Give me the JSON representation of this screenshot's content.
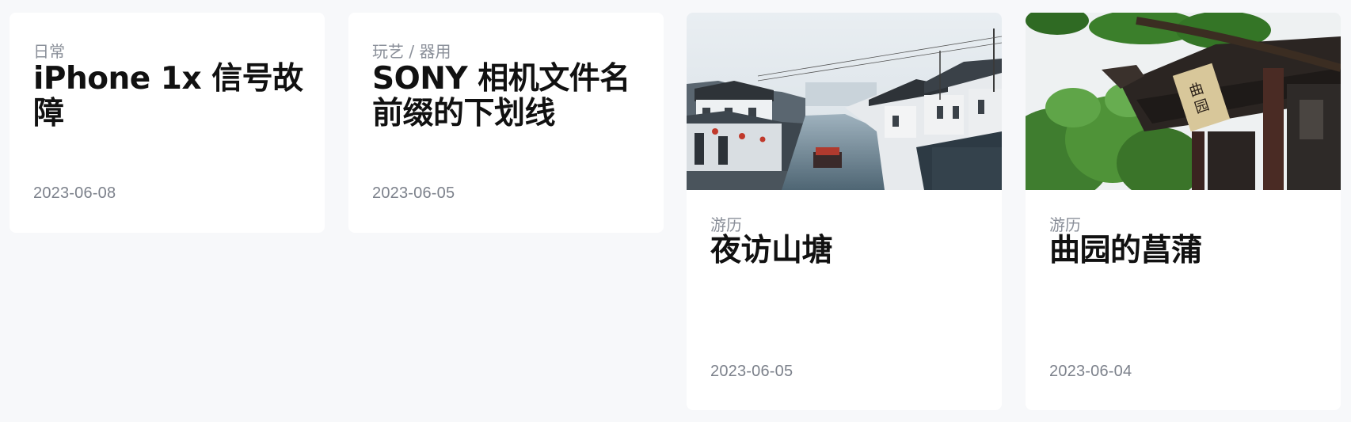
{
  "cards": [
    {
      "category": "日常",
      "title": "iPhone 1x 信号故障",
      "date": "2023-06-08"
    },
    {
      "category": "玩艺 / 器用",
      "title": "SONY 相机文件名前缀的下划线",
      "date": "2023-06-05"
    },
    {
      "category": "游历",
      "title": "夜访山塘",
      "date": "2023-06-05",
      "image": "canal-town-photo"
    },
    {
      "category": "游历",
      "title": "曲园的菖蒲",
      "date": "2023-06-04",
      "image": "pavilion-eaves-photo"
    }
  ],
  "colors": {
    "page_background": "#f7f8fa",
    "card_background": "#ffffff",
    "meta_text": "#8a8f99",
    "title_text": "#111111"
  }
}
